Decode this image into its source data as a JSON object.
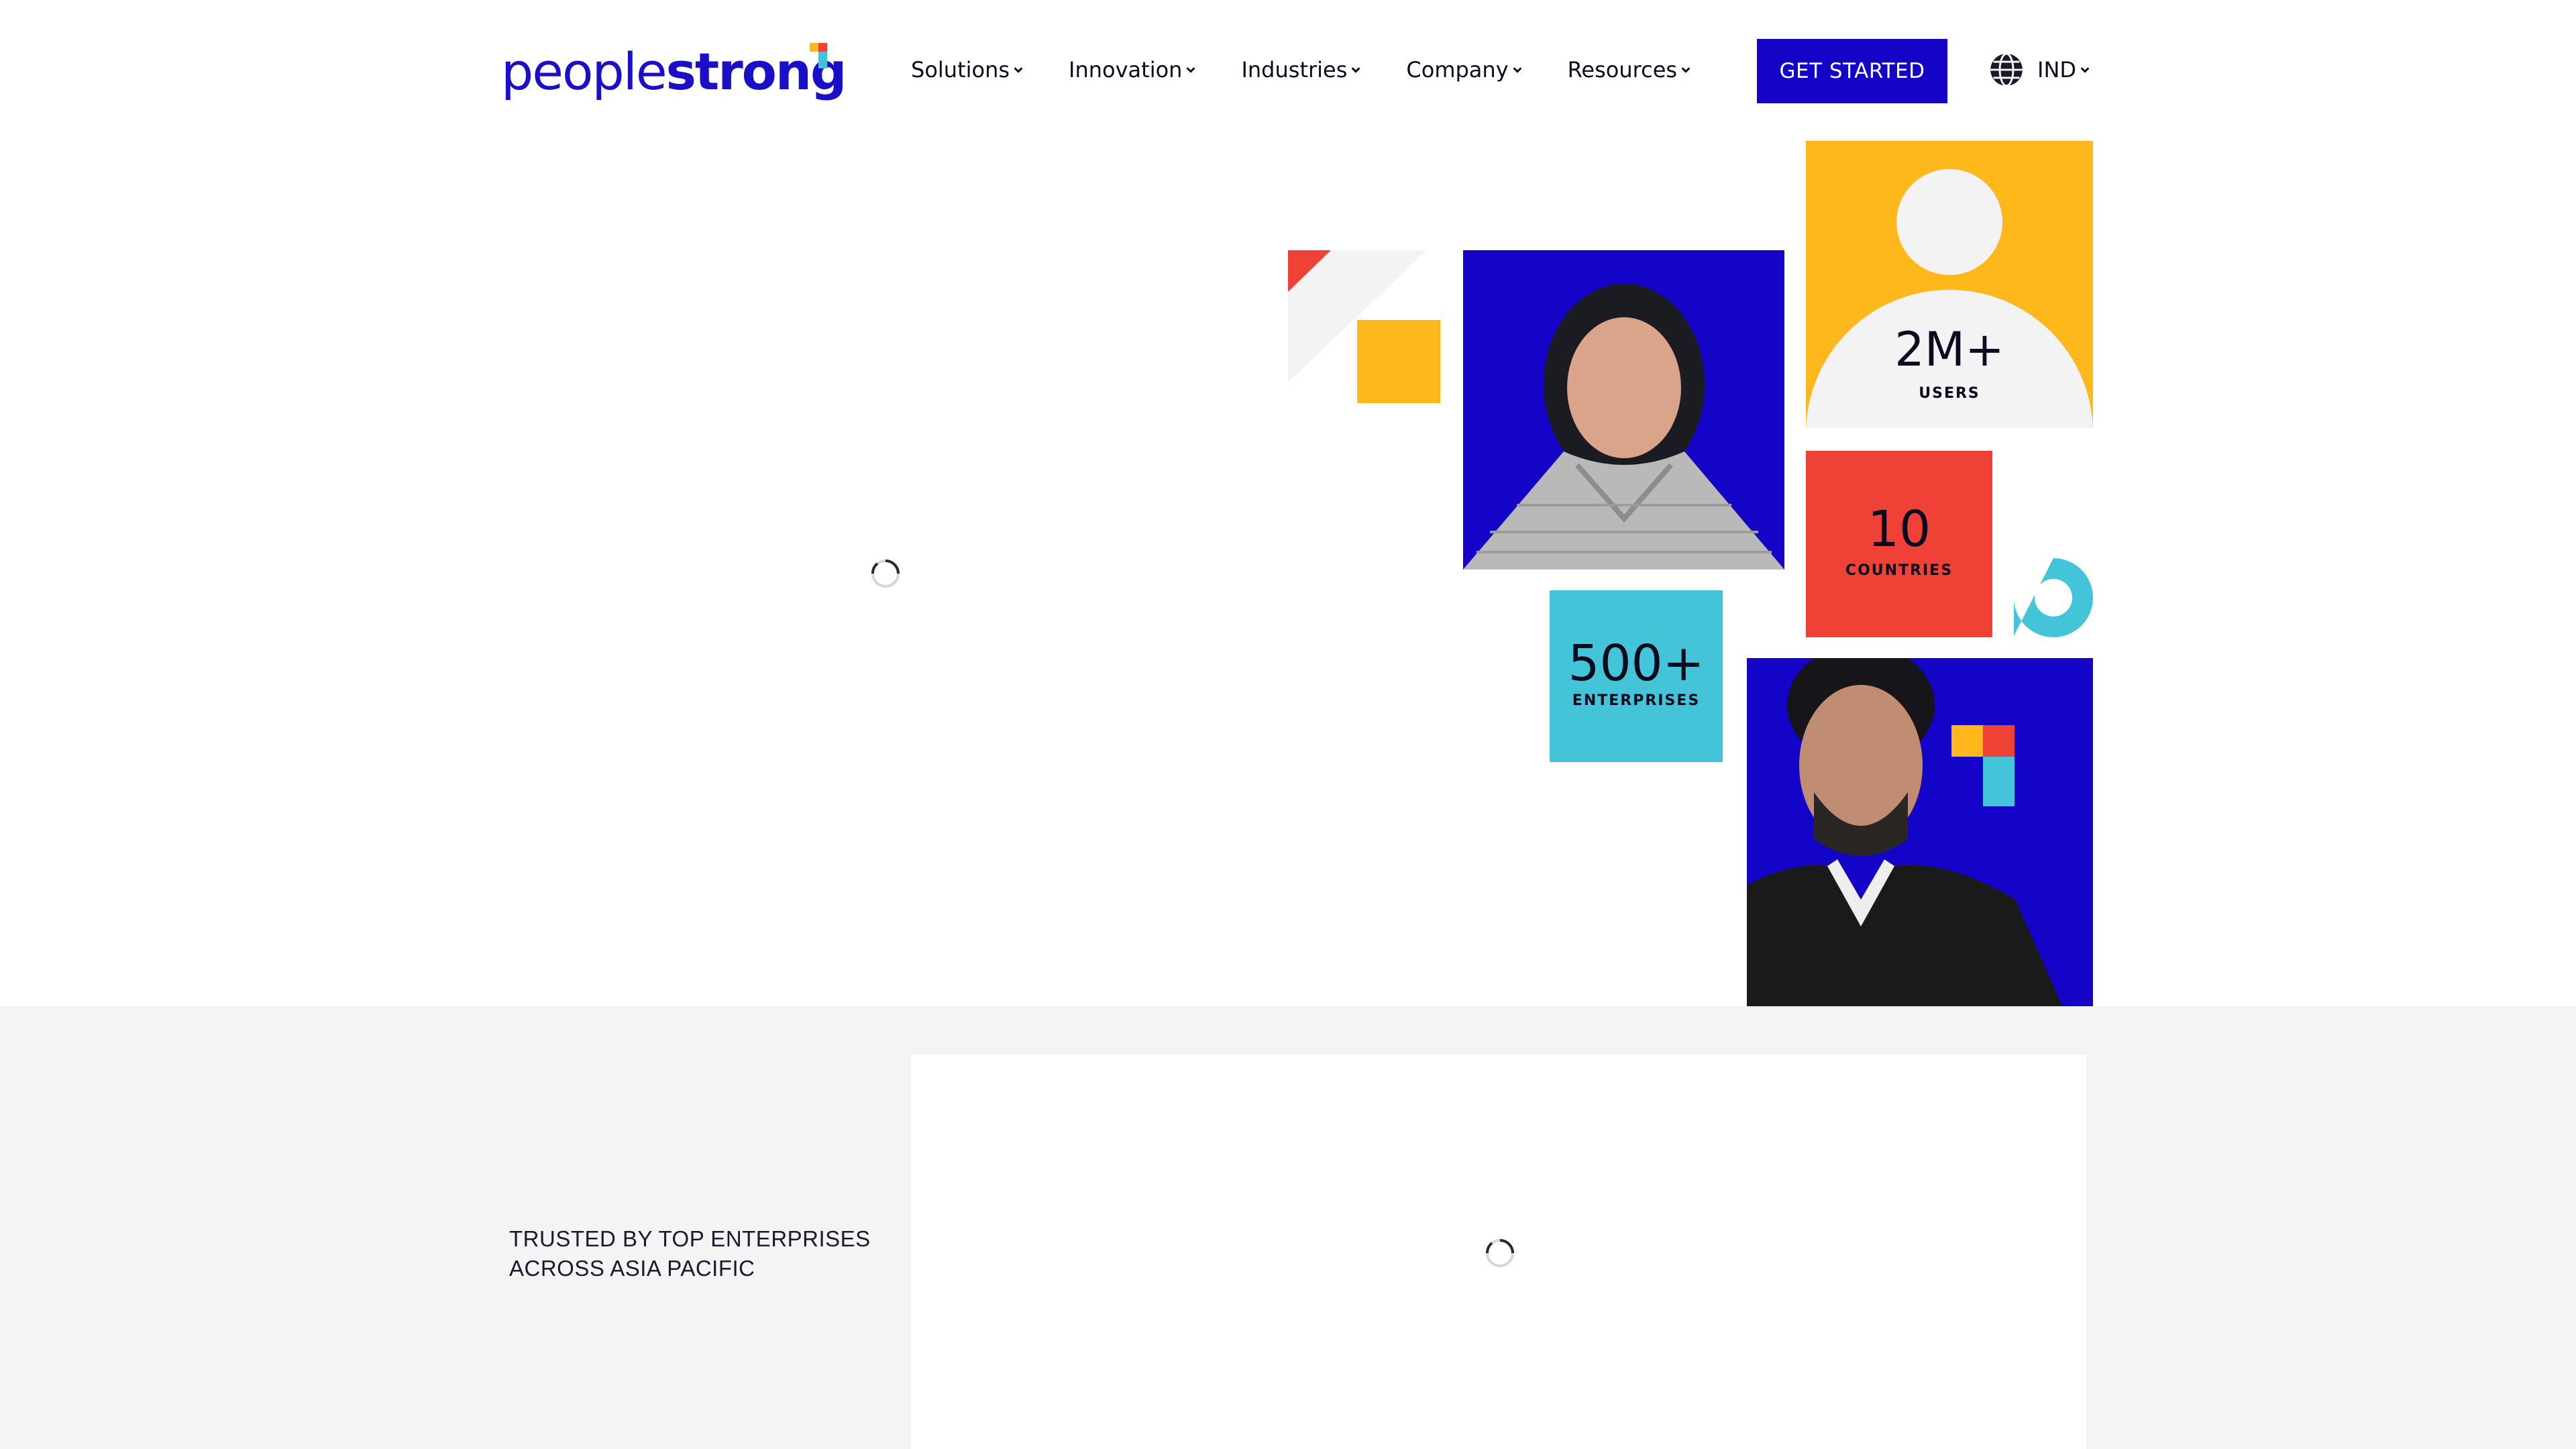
{
  "header": {
    "logo": {
      "part1": "people",
      "part2": "strong",
      "colors": [
        "#ffb81c",
        "#ef4135",
        "#44c4d8"
      ]
    },
    "nav": [
      {
        "label": "Solutions"
      },
      {
        "label": "Innovation"
      },
      {
        "label": "Industries"
      },
      {
        "label": "Company"
      },
      {
        "label": "Resources"
      }
    ],
    "cta_label": "GET STARTED",
    "locale": {
      "label": "IND",
      "icon": "globe-icon"
    }
  },
  "hero": {
    "loading_icon": "spinner-icon",
    "stats": {
      "users": {
        "value": "2M+",
        "label": "USERS"
      },
      "countries": {
        "value": "10",
        "label": "COUNTRIES"
      },
      "enterprises": {
        "value": "500+",
        "label": "ENTERPRISES"
      }
    },
    "colors": {
      "brand_blue": "#1404c8",
      "yellow": "#ffb81c",
      "red": "#ef4135",
      "cyan": "#44c4d8"
    }
  },
  "trusted": {
    "label_line1": "TRUSTED BY TOP ENTERPRISES",
    "label_line2": "ACROSS ASIA PACIFIC",
    "loading_icon": "spinner-icon"
  }
}
